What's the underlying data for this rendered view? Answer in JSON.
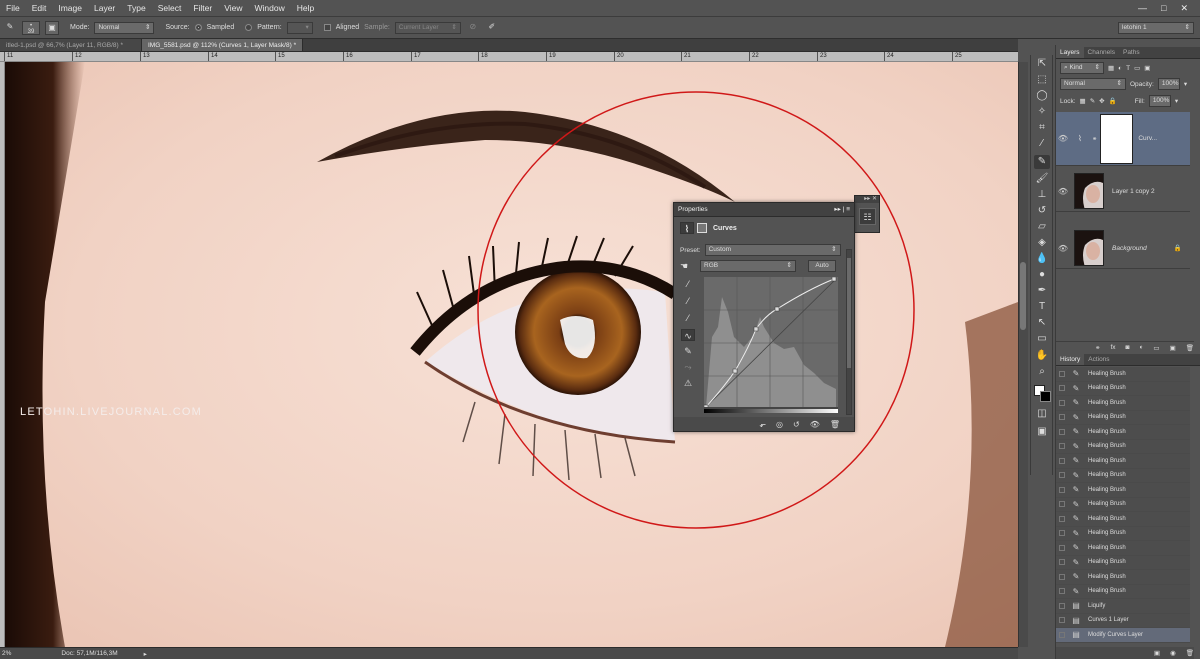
{
  "menu": {
    "items": [
      "File",
      "Edit",
      "Image",
      "Layer",
      "Type",
      "Select",
      "Filter",
      "View",
      "Window",
      "Help"
    ],
    "window_buttons": {
      "minimize": "—",
      "maximize": "□",
      "close": "✕"
    }
  },
  "options": {
    "brush_size": "39",
    "mode_label": "Mode:",
    "mode_value": "Normal",
    "source_label": "Source:",
    "sampled_label": "Sampled",
    "pattern_label": "Pattern:",
    "aligned_label": "Aligned",
    "sample_label": "Sample:",
    "sample_value": "Current Layer",
    "workspace_value": "letohin 1"
  },
  "tabs": [
    {
      "label": "itled-1.psd @ 66,7% (Layer 11, RGB/8) *"
    },
    {
      "label": "IMG_5581.psd @ 112% (Curves 1, Layer Mask/8) *"
    }
  ],
  "ruler": {
    "ticks": [
      "11",
      "12",
      "13",
      "14",
      "15",
      "16",
      "17",
      "18",
      "19",
      "20",
      "21",
      "22",
      "23",
      "24",
      "25"
    ]
  },
  "canvas": {
    "watermark": "LETOHIN.LIVEJOURNAL.COM"
  },
  "status": {
    "zoom": "2%",
    "doc": "Doc: 57,1M/116,3M"
  },
  "properties": {
    "tab_label": "Properties",
    "adjust_label": "Curves",
    "preset_label": "Preset:",
    "preset_value": "Custom",
    "channel_value": "RGB",
    "auto_label": "Auto"
  },
  "layers_panel": {
    "tabs": [
      "Layers",
      "Channels",
      "Paths"
    ],
    "kind_label": "Kind",
    "blend_mode": "Normal",
    "opacity_label": "Opacity:",
    "opacity_value": "100%",
    "lock_label": "Lock:",
    "fill_label": "Fill:",
    "fill_value": "100%",
    "layers": [
      {
        "name": "Curv..."
      },
      {
        "name": "Layer 1 copy 2"
      },
      {
        "name": "Background"
      }
    ]
  },
  "history_panel": {
    "tabs": [
      "History",
      "Actions"
    ],
    "items": [
      {
        "label": "Healing Brush",
        "icon": "brush-icon"
      },
      {
        "label": "Healing Brush",
        "icon": "brush-icon"
      },
      {
        "label": "Healing Brush",
        "icon": "brush-icon"
      },
      {
        "label": "Healing Brush",
        "icon": "brush-icon"
      },
      {
        "label": "Healing Brush",
        "icon": "brush-icon"
      },
      {
        "label": "Healing Brush",
        "icon": "brush-icon"
      },
      {
        "label": "Healing Brush",
        "icon": "brush-icon"
      },
      {
        "label": "Healing Brush",
        "icon": "brush-icon"
      },
      {
        "label": "Healing Brush",
        "icon": "brush-icon"
      },
      {
        "label": "Healing Brush",
        "icon": "brush-icon"
      },
      {
        "label": "Healing Brush",
        "icon": "brush-icon"
      },
      {
        "label": "Healing Brush",
        "icon": "brush-icon"
      },
      {
        "label": "Healing Brush",
        "icon": "brush-icon"
      },
      {
        "label": "Healing Brush",
        "icon": "brush-icon"
      },
      {
        "label": "Healing Brush",
        "icon": "brush-icon"
      },
      {
        "label": "Healing Brush",
        "icon": "brush-icon"
      },
      {
        "label": "Liquify",
        "icon": "doc-icon"
      },
      {
        "label": "Curves 1 Layer",
        "icon": "doc-icon"
      },
      {
        "label": "Modify Curves Layer",
        "icon": "doc-icon"
      }
    ],
    "current_index": 18
  },
  "colors": {
    "highlight_circle": "#d01818",
    "ui_bg": "#535353",
    "selected_layer": "#5e6c84",
    "history_current": "#636a79"
  }
}
